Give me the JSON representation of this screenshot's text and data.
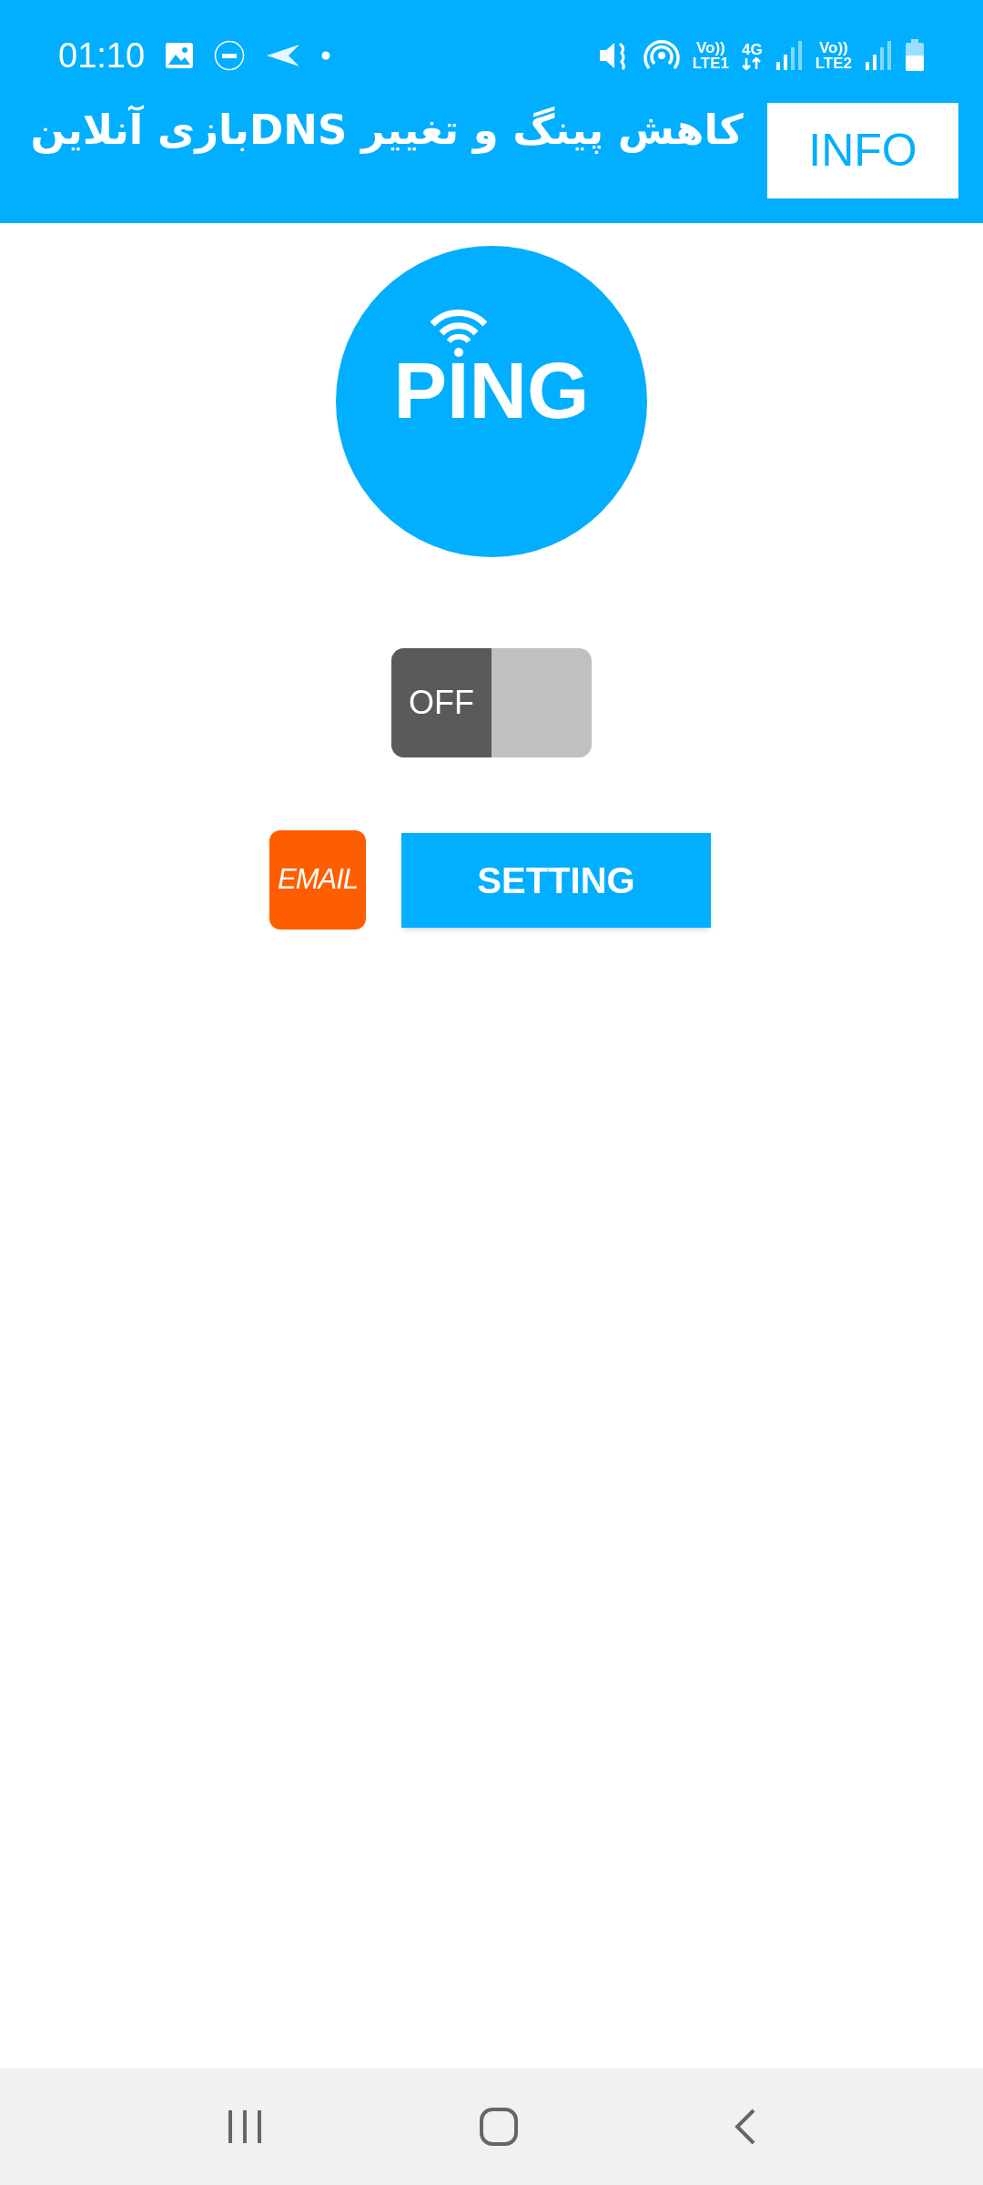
{
  "status_bar": {
    "time": "01:10",
    "sim1": {
      "volte": "Vo))",
      "network": "LTE1"
    },
    "data_type": "4G",
    "sim2": {
      "volte": "Vo))",
      "network": "LTE2"
    }
  },
  "header": {
    "title": "کاهش پینگ و تغییر DNSبازی آنلاین",
    "info_button": "INFO"
  },
  "logo": {
    "text": "PING"
  },
  "toggle": {
    "label": "OFF",
    "on": false
  },
  "buttons": {
    "email": "EMAIL",
    "setting": "SETTING"
  }
}
